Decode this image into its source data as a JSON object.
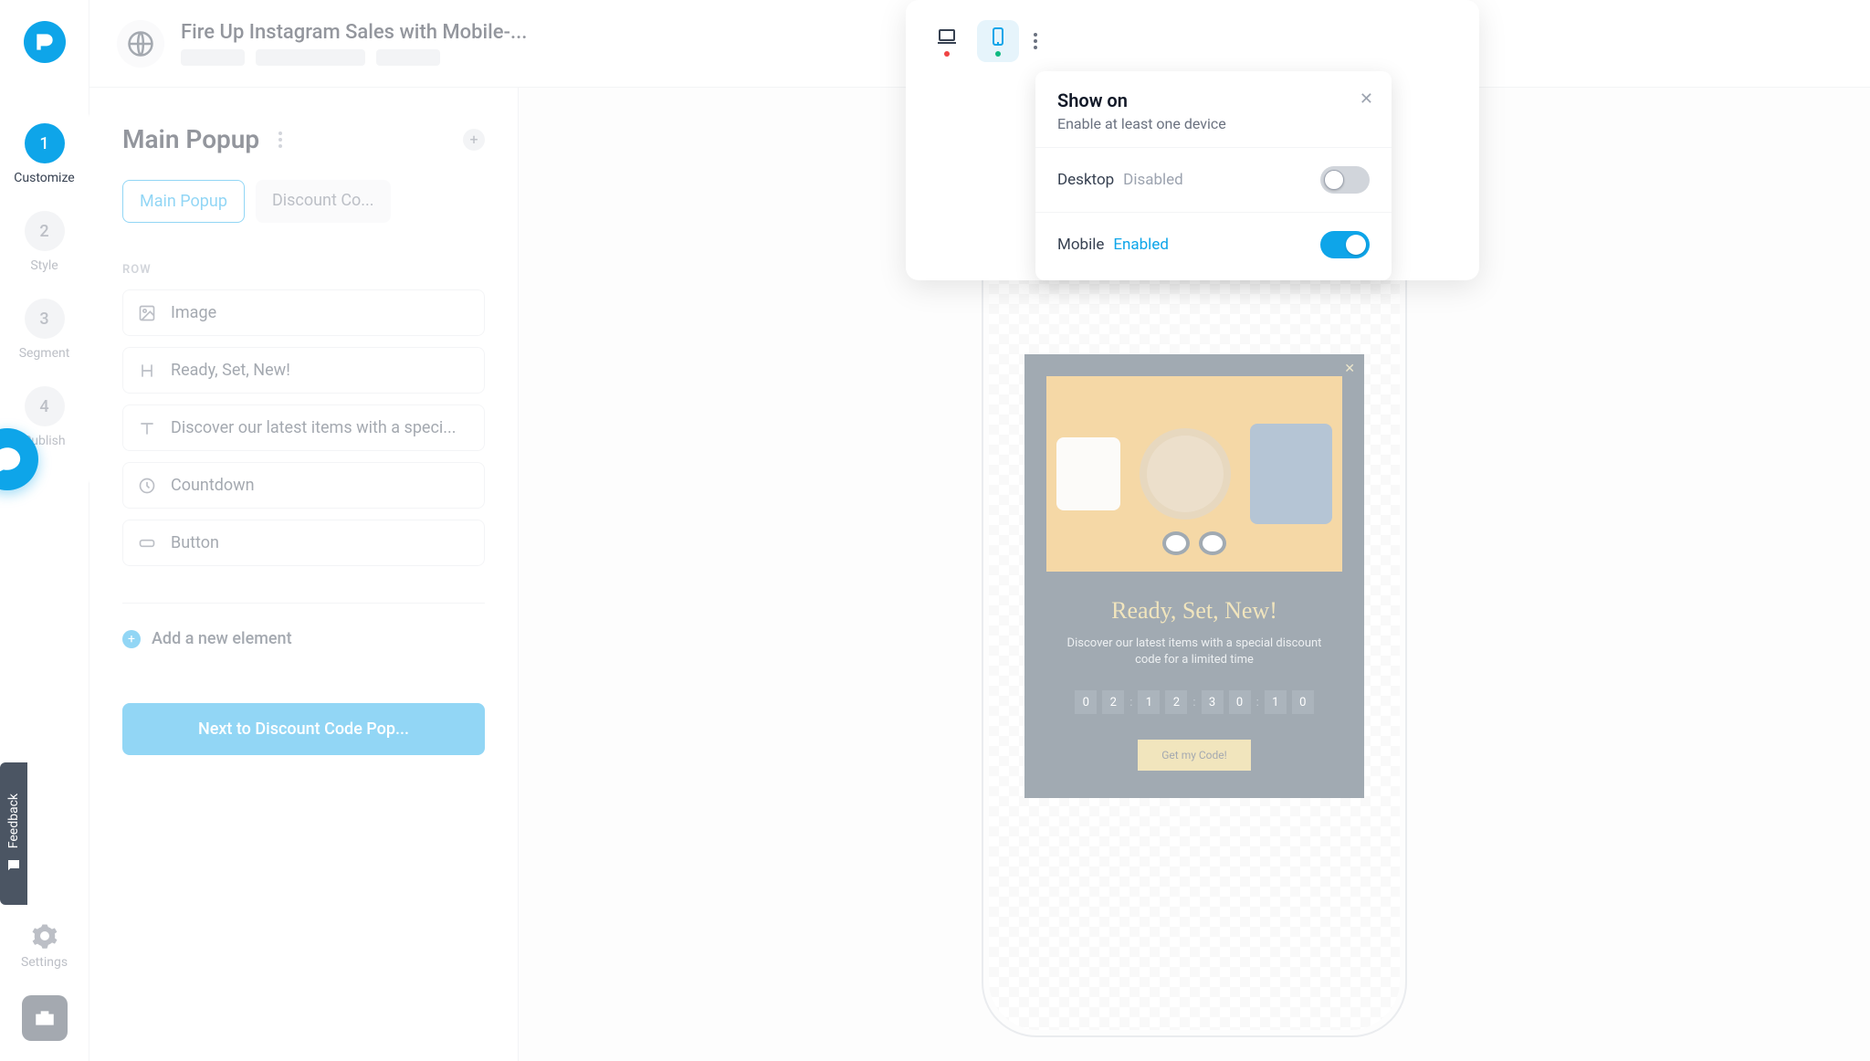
{
  "header": {
    "title": "Fire Up Instagram Sales with Mobile-..."
  },
  "rail": {
    "steps": [
      {
        "num": "1",
        "label": "Customize",
        "active": true
      },
      {
        "num": "2",
        "label": "Style"
      },
      {
        "num": "3",
        "label": "Segment"
      },
      {
        "num": "4",
        "label": "Publish"
      }
    ],
    "settings_label": "Settings"
  },
  "editor": {
    "title": "Main Popup",
    "tabs": [
      {
        "label": "Main Popup",
        "active": true
      },
      {
        "label": "Discount Co..."
      }
    ],
    "row_label": "ROW",
    "elements": [
      {
        "icon": "image",
        "label": "Image"
      },
      {
        "icon": "heading",
        "label": "Ready, Set, New!"
      },
      {
        "icon": "text",
        "label": "Discover our latest items with a speci..."
      },
      {
        "icon": "clock",
        "label": "Countdown"
      },
      {
        "icon": "button",
        "label": "Button"
      }
    ],
    "add_element_label": "Add a new element",
    "next_label": "Next to Discount Code Pop..."
  },
  "preview": {
    "popover": {
      "title": "Show on",
      "subtitle": "Enable at least one device",
      "rows": [
        {
          "device": "Desktop",
          "state_label": "Disabled",
          "enabled": false
        },
        {
          "device": "Mobile",
          "state_label": "Enabled",
          "enabled": true
        }
      ]
    }
  },
  "popup_preview": {
    "heading": "Ready, Set, New!",
    "paragraph": "Discover our latest items with a special discount code for a limited time",
    "countdown": [
      "0",
      "2",
      "1",
      "2",
      "3",
      "0",
      "1",
      "0"
    ],
    "button": "Get my Code!"
  },
  "feedback_label": "Feedback"
}
